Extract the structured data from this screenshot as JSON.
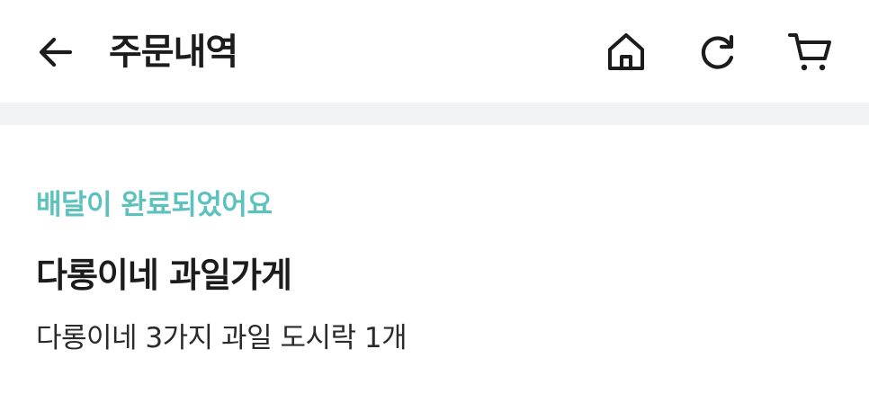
{
  "header": {
    "title": "주문내역",
    "icons": {
      "back": "arrow-left-icon",
      "home": "home-icon",
      "refresh": "refresh-icon",
      "cart": "cart-icon"
    }
  },
  "order": {
    "status": "배달이 완료되었어요",
    "store_name": "다롱이네 과일가게",
    "summary": "다롱이네 3가지 과일 도시락 1개"
  },
  "colors": {
    "status_accent": "#5dc1bd",
    "divider_band": "#f1f3f4",
    "text_primary": "#1c1c1c"
  }
}
